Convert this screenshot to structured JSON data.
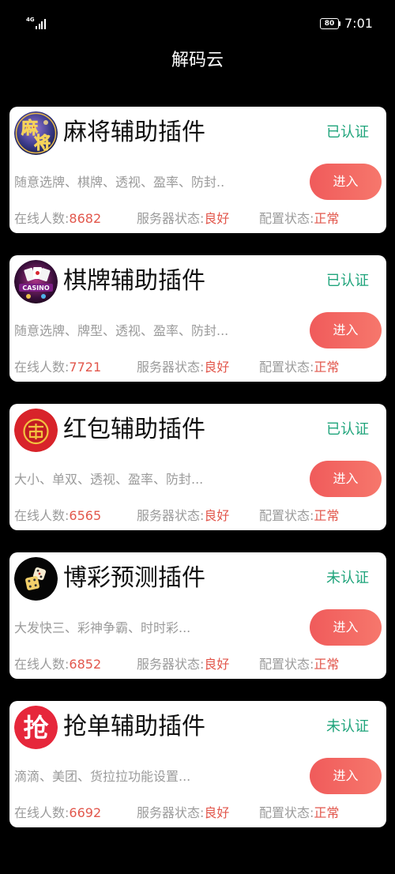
{
  "status_bar": {
    "network": "4G",
    "battery": "80",
    "time": "7:01"
  },
  "header": {
    "title": "解码云"
  },
  "colors": {
    "background": "#000000",
    "card": "#ffffff",
    "verified": "#1fa47b",
    "value": "#e2574c",
    "muted": "#9b9b9b",
    "button_from": "#f05b5b",
    "button_to": "#f6776c"
  },
  "plugins": [
    {
      "icon": "mahjong-logo-icon",
      "logo_text": [
        "麻",
        "将"
      ],
      "title": "麻将辅助插件",
      "status": "已认证",
      "description": "随意选牌、棋牌、透视、盈率、防封..",
      "enter": "进入",
      "online_label": "在线人数:",
      "online_count": "8682",
      "server_label": "服务器状态:",
      "server_status": "良好",
      "config_label": "配置状态:",
      "config_status": "正常"
    },
    {
      "icon": "casino-logo-icon",
      "logo_text": [
        "CASINO"
      ],
      "title": "棋牌辅助插件",
      "status": "已认证",
      "description": "随意选牌、牌型、透视、盈率、防封...",
      "enter": "进入",
      "online_label": "在线人数:",
      "online_count": "7721",
      "server_label": "服务器状态:",
      "server_status": "良好",
      "config_label": "配置状态:",
      "config_status": "正常"
    },
    {
      "icon": "red-envelope-icon",
      "title": "红包辅助插件",
      "status": "已认证",
      "description": "大小、单双、透视、盈率、防封...",
      "enter": "进入",
      "online_label": "在线人数:",
      "online_count": "6565",
      "server_label": "服务器状态:",
      "server_status": "良好",
      "config_label": "配置状态:",
      "config_status": "正常"
    },
    {
      "icon": "dice-icon",
      "title": "博彩预测插件",
      "status": "未认证",
      "description": "大发快三、彩神争霸、时时彩...",
      "enter": "进入",
      "online_label": "在线人数:",
      "online_count": "6852",
      "server_label": "服务器状态:",
      "server_status": "良好",
      "config_label": "配置状态:",
      "config_status": "正常"
    },
    {
      "icon": "grab-order-icon",
      "logo_text": [
        "抢"
      ],
      "title": "抢单辅助插件",
      "status": "未认证",
      "description": "滴滴、美团、货拉拉功能设置...",
      "enter": "进入",
      "online_label": "在线人数:",
      "online_count": "6692",
      "server_label": "服务器状态:",
      "server_status": "良好",
      "config_label": "配置状态:",
      "config_status": "正常"
    }
  ]
}
